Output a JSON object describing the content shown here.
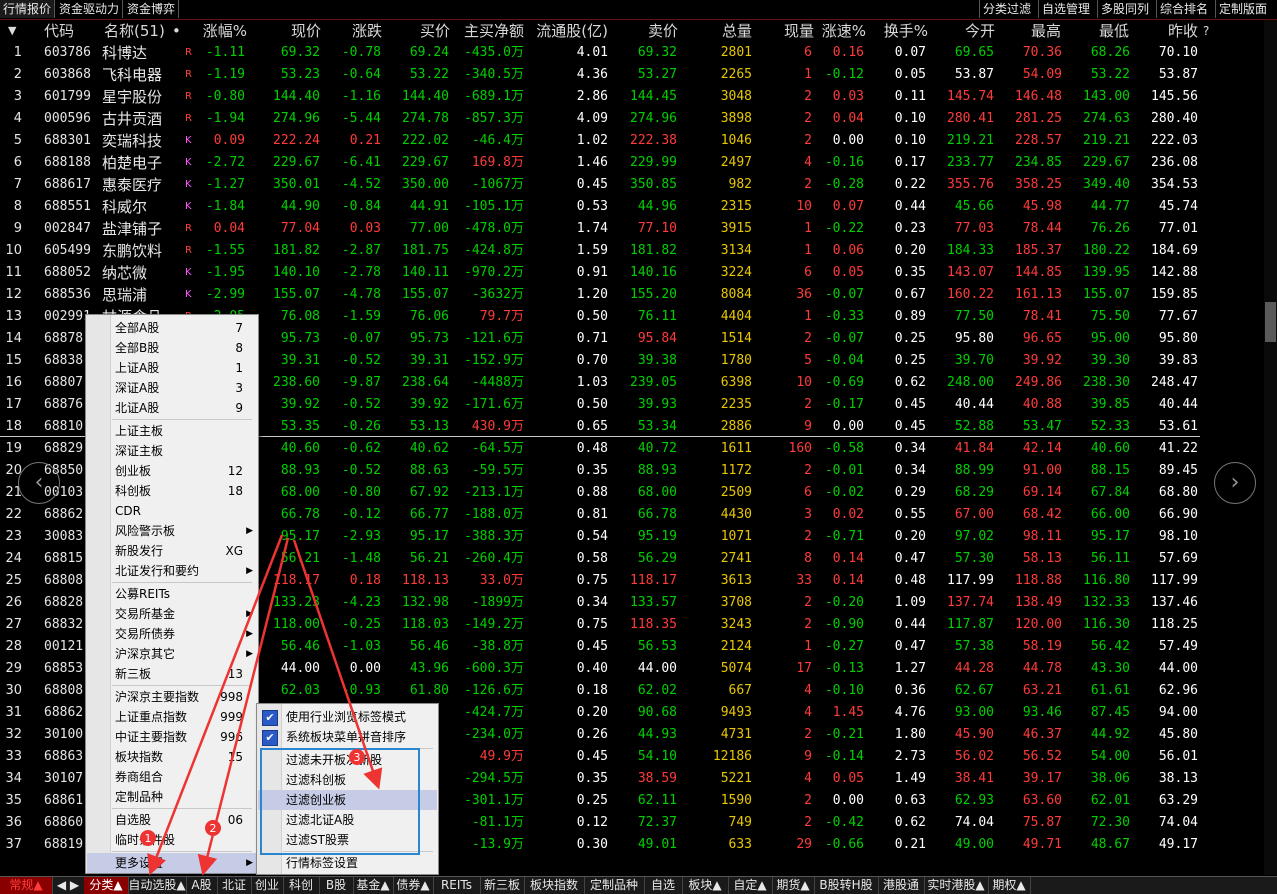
{
  "top_tabs": [
    "行情报价",
    "资金驱动力",
    "资金博弈"
  ],
  "top_right": [
    "分类过滤",
    "自选管理",
    "多股同列",
    "综合排名",
    "定制版面"
  ],
  "columns": [
    "代码",
    "名称(51)",
    "•",
    "涨幅%",
    "现价",
    "涨跌",
    "买价",
    "主买净额",
    "流通股(亿)",
    "卖价",
    "总量",
    "现量",
    "涨速%",
    "换手%",
    "今开",
    "最高",
    "最低",
    "昨收",
    "?"
  ],
  "rows": [
    {
      "n": "1",
      "code": "603786",
      "name": "科博达",
      "flag": "R",
      "chg_pct": "-1.11",
      "price": "69.32",
      "chg": "-0.78",
      "bid": "69.24",
      "net": "-435.0万",
      "float": "4.01",
      "ask": "69.32",
      "vol": "2801",
      "cur": "6",
      "speed": "0.16",
      "turn": "0.07",
      "open": "69.65",
      "high": "70.36",
      "low": "68.26",
      "prev": "70.10"
    },
    {
      "n": "2",
      "code": "603868",
      "name": "飞科电器",
      "flag": "R",
      "chg_pct": "-1.19",
      "price": "53.23",
      "chg": "-0.64",
      "bid": "53.22",
      "net": "-340.5万",
      "float": "4.36",
      "ask": "53.27",
      "vol": "2265",
      "cur": "1",
      "speed": "-0.12",
      "turn": "0.05",
      "open": "53.87",
      "high": "54.09",
      "low": "53.22",
      "prev": "53.87"
    },
    {
      "n": "3",
      "code": "601799",
      "name": "星宇股份",
      "flag": "R",
      "chg_pct": "-0.80",
      "price": "144.40",
      "chg": "-1.16",
      "bid": "144.40",
      "net": "-689.1万",
      "float": "2.86",
      "ask": "144.45",
      "vol": "3048",
      "cur": "2",
      "speed": "0.03",
      "turn": "0.11",
      "open": "145.74",
      "high": "146.48",
      "low": "143.00",
      "prev": "145.56"
    },
    {
      "n": "4",
      "code": "000596",
      "name": "古井贡酒",
      "flag": "R",
      "chg_pct": "-1.94",
      "price": "274.96",
      "chg": "-5.44",
      "bid": "274.78",
      "net": "-857.3万",
      "float": "4.09",
      "ask": "274.96",
      "vol": "3898",
      "cur": "2",
      "speed": "0.04",
      "turn": "0.10",
      "open": "280.41",
      "high": "281.25",
      "low": "274.63",
      "prev": "280.40"
    },
    {
      "n": "5",
      "code": "688301",
      "name": "奕瑞科技",
      "flag": "K",
      "chg_pct": "0.09",
      "price": "222.24",
      "chg": "0.21",
      "bid": "222.02",
      "net": "-46.4万",
      "float": "1.02",
      "ask": "222.38",
      "vol": "1046",
      "cur": "2",
      "speed": "0.00",
      "turn": "0.10",
      "open": "219.21",
      "high": "228.57",
      "low": "219.21",
      "prev": "222.03"
    },
    {
      "n": "6",
      "code": "688188",
      "name": "柏楚电子",
      "flag": "K",
      "chg_pct": "-2.72",
      "price": "229.67",
      "chg": "-6.41",
      "bid": "229.67",
      "net": "169.8万",
      "float": "1.46",
      "ask": "229.99",
      "vol": "2497",
      "cur": "4",
      "speed": "-0.16",
      "turn": "0.17",
      "open": "233.77",
      "high": "234.85",
      "low": "229.67",
      "prev": "236.08"
    },
    {
      "n": "7",
      "code": "688617",
      "name": "惠泰医疗",
      "flag": "K",
      "chg_pct": "-1.27",
      "price": "350.01",
      "chg": "-4.52",
      "bid": "350.00",
      "net": "-1067万",
      "float": "0.45",
      "ask": "350.85",
      "vol": "982",
      "cur": "2",
      "speed": "-0.28",
      "turn": "0.22",
      "open": "355.76",
      "high": "358.25",
      "low": "349.40",
      "prev": "354.53"
    },
    {
      "n": "8",
      "code": "688551",
      "name": "科威尔",
      "flag": "K",
      "chg_pct": "-1.84",
      "price": "44.90",
      "chg": "-0.84",
      "bid": "44.91",
      "net": "-105.1万",
      "float": "0.53",
      "ask": "44.96",
      "vol": "2315",
      "cur": "10",
      "speed": "0.07",
      "turn": "0.44",
      "open": "45.66",
      "high": "45.98",
      "low": "44.77",
      "prev": "45.74"
    },
    {
      "n": "9",
      "code": "002847",
      "name": "盐津铺子",
      "flag": "R",
      "chg_pct": "0.04",
      "price": "77.04",
      "chg": "0.03",
      "bid": "77.00",
      "net": "-478.0万",
      "float": "1.74",
      "ask": "77.10",
      "vol": "3915",
      "cur": "1",
      "speed": "-0.22",
      "turn": "0.23",
      "open": "77.03",
      "high": "78.44",
      "low": "76.26",
      "prev": "77.01"
    },
    {
      "n": "10",
      "code": "605499",
      "name": "东鹏饮料",
      "flag": "R",
      "chg_pct": "-1.55",
      "price": "181.82",
      "chg": "-2.87",
      "bid": "181.75",
      "net": "-424.8万",
      "float": "1.59",
      "ask": "181.82",
      "vol": "3134",
      "cur": "1",
      "speed": "0.06",
      "turn": "0.20",
      "open": "184.33",
      "high": "185.37",
      "low": "180.22",
      "prev": "184.69"
    },
    {
      "n": "11",
      "code": "688052",
      "name": "纳芯微",
      "flag": "K",
      "chg_pct": "-1.95",
      "price": "140.10",
      "chg": "-2.78",
      "bid": "140.11",
      "net": "-970.2万",
      "float": "0.91",
      "ask": "140.16",
      "vol": "3224",
      "cur": "6",
      "speed": "0.05",
      "turn": "0.35",
      "open": "143.07",
      "high": "144.85",
      "low": "139.95",
      "prev": "142.88"
    },
    {
      "n": "12",
      "code": "688536",
      "name": "思瑞浦",
      "flag": "K",
      "chg_pct": "-2.99",
      "price": "155.07",
      "chg": "-4.78",
      "bid": "155.07",
      "net": "-3632万",
      "float": "1.20",
      "ask": "155.20",
      "vol": "8084",
      "cur": "36",
      "speed": "-0.07",
      "turn": "0.67",
      "open": "160.22",
      "high": "161.13",
      "low": "155.07",
      "prev": "159.85"
    },
    {
      "n": "13",
      "code": "002991",
      "name": "甘源食品",
      "flag": "R",
      "chg_pct": "-2.05",
      "price": "76.08",
      "chg": "-1.59",
      "bid": "76.06",
      "net": "79.7万",
      "float": "0.50",
      "ask": "76.11",
      "vol": "4404",
      "cur": "1",
      "speed": "-0.33",
      "turn": "0.89",
      "open": "77.50",
      "high": "78.41",
      "low": "75.50",
      "prev": "77.67"
    },
    {
      "n": "14",
      "code": "68878",
      "name": "",
      "flag": "",
      "chg_pct": "",
      "price": "95.73",
      "chg": "-0.07",
      "bid": "95.73",
      "net": "-121.6万",
      "float": "0.71",
      "ask": "95.84",
      "vol": "1514",
      "cur": "2",
      "speed": "-0.07",
      "turn": "0.25",
      "open": "95.80",
      "high": "96.65",
      "low": "95.00",
      "prev": "95.80"
    },
    {
      "n": "15",
      "code": "68838",
      "name": "",
      "flag": "",
      "chg_pct": "",
      "price": "39.31",
      "chg": "-0.52",
      "bid": "39.31",
      "net": "-152.9万",
      "float": "0.70",
      "ask": "39.38",
      "vol": "1780",
      "cur": "5",
      "speed": "-0.04",
      "turn": "0.25",
      "open": "39.70",
      "high": "39.92",
      "low": "39.30",
      "prev": "39.83"
    },
    {
      "n": "16",
      "code": "68807",
      "name": "",
      "flag": "",
      "chg_pct": "",
      "price": "238.60",
      "chg": "-9.87",
      "bid": "238.64",
      "net": "-4488万",
      "float": "1.03",
      "ask": "239.05",
      "vol": "6398",
      "cur": "10",
      "speed": "-0.69",
      "turn": "0.62",
      "open": "248.00",
      "high": "249.86",
      "low": "238.30",
      "prev": "248.47"
    },
    {
      "n": "17",
      "code": "68876",
      "name": "",
      "flag": "",
      "chg_pct": "",
      "price": "39.92",
      "chg": "-0.52",
      "bid": "39.92",
      "net": "-171.6万",
      "float": "0.50",
      "ask": "39.93",
      "vol": "2235",
      "cur": "2",
      "speed": "-0.17",
      "turn": "0.45",
      "open": "40.44",
      "high": "40.88",
      "low": "39.85",
      "prev": "40.44"
    },
    {
      "n": "18",
      "code": "68810",
      "name": "",
      "flag": "",
      "chg_pct": "",
      "price": "53.35",
      "chg": "-0.26",
      "bid": "53.13",
      "net": "430.9万",
      "float": "0.65",
      "ask": "53.34",
      "vol": "2886",
      "cur": "9",
      "speed": "0.00",
      "turn": "0.45",
      "open": "52.88",
      "high": "53.47",
      "low": "52.33",
      "prev": "53.61"
    },
    {
      "n": "19",
      "code": "68829",
      "name": "",
      "flag": "",
      "chg_pct": "",
      "price": "40.60",
      "chg": "-0.62",
      "bid": "40.62",
      "net": "-64.5万",
      "float": "0.48",
      "ask": "40.72",
      "vol": "1611",
      "cur": "160",
      "speed": "-0.58",
      "turn": "0.34",
      "open": "41.84",
      "high": "42.14",
      "low": "40.60",
      "prev": "41.22"
    },
    {
      "n": "20",
      "code": "68850",
      "name": "",
      "flag": "",
      "chg_pct": "",
      "price": "88.93",
      "chg": "-0.52",
      "bid": "88.63",
      "net": "-59.5万",
      "float": "0.35",
      "ask": "88.93",
      "vol": "1172",
      "cur": "2",
      "speed": "-0.01",
      "turn": "0.34",
      "open": "88.99",
      "high": "91.00",
      "low": "88.15",
      "prev": "89.45"
    },
    {
      "n": "21",
      "code": "00103",
      "name": "",
      "flag": "",
      "chg_pct": "",
      "price": "68.00",
      "chg": "-0.80",
      "bid": "67.92",
      "net": "-213.1万",
      "float": "0.88",
      "ask": "68.00",
      "vol": "2509",
      "cur": "6",
      "speed": "-0.02",
      "turn": "0.29",
      "open": "68.29",
      "high": "69.14",
      "low": "67.84",
      "prev": "68.80"
    },
    {
      "n": "22",
      "code": "68862",
      "name": "",
      "flag": "",
      "chg_pct": "",
      "price": "66.78",
      "chg": "-0.12",
      "bid": "66.77",
      "net": "-188.0万",
      "float": "0.81",
      "ask": "66.78",
      "vol": "4430",
      "cur": "3",
      "speed": "0.02",
      "turn": "0.55",
      "open": "67.00",
      "high": "68.42",
      "low": "66.00",
      "prev": "66.90"
    },
    {
      "n": "23",
      "code": "30083",
      "name": "",
      "flag": "",
      "chg_pct": "",
      "price": "95.17",
      "chg": "-2.93",
      "bid": "95.17",
      "net": "-388.3万",
      "float": "0.54",
      "ask": "95.19",
      "vol": "1071",
      "cur": "2",
      "speed": "-0.71",
      "turn": "0.20",
      "open": "97.02",
      "high": "98.11",
      "low": "95.17",
      "prev": "98.10"
    },
    {
      "n": "24",
      "code": "68815",
      "name": "",
      "flag": "",
      "chg_pct": "",
      "price": "56.21",
      "chg": "-1.48",
      "bid": "56.21",
      "net": "-260.4万",
      "float": "0.58",
      "ask": "56.29",
      "vol": "2741",
      "cur": "8",
      "speed": "0.14",
      "turn": "0.47",
      "open": "57.30",
      "high": "58.13",
      "low": "56.11",
      "prev": "57.69"
    },
    {
      "n": "25",
      "code": "68808",
      "name": "",
      "flag": "",
      "chg_pct": "",
      "price": "118.17",
      "chg": "0.18",
      "bid": "118.13",
      "net": "33.0万",
      "float": "0.75",
      "ask": "118.17",
      "vol": "3613",
      "cur": "33",
      "speed": "0.14",
      "turn": "0.48",
      "open": "117.99",
      "high": "118.88",
      "low": "116.80",
      "prev": "117.99"
    },
    {
      "n": "26",
      "code": "68828",
      "name": "",
      "flag": "",
      "chg_pct": "",
      "price": "133.23",
      "chg": "-4.23",
      "bid": "132.98",
      "net": "-1899万",
      "float": "0.34",
      "ask": "133.57",
      "vol": "3708",
      "cur": "2",
      "speed": "-0.20",
      "turn": "1.09",
      "open": "137.74",
      "high": "138.49",
      "low": "132.33",
      "prev": "137.46"
    },
    {
      "n": "27",
      "code": "68832",
      "name": "",
      "flag": "",
      "chg_pct": "",
      "price": "118.00",
      "chg": "-0.25",
      "bid": "118.03",
      "net": "-149.2万",
      "float": "0.75",
      "ask": "118.35",
      "vol": "3243",
      "cur": "2",
      "speed": "-0.90",
      "turn": "0.44",
      "open": "117.87",
      "high": "120.00",
      "low": "116.30",
      "prev": "118.25"
    },
    {
      "n": "28",
      "code": "00121",
      "name": "",
      "flag": "",
      "chg_pct": "",
      "price": "56.46",
      "chg": "-1.03",
      "bid": "56.46",
      "net": "-38.8万",
      "float": "0.45",
      "ask": "56.53",
      "vol": "2124",
      "cur": "1",
      "speed": "-0.27",
      "turn": "0.47",
      "open": "57.38",
      "high": "58.19",
      "low": "56.42",
      "prev": "57.49"
    },
    {
      "n": "29",
      "code": "68853",
      "name": "",
      "flag": "",
      "chg_pct": "",
      "price": "44.00",
      "chg": "0.00",
      "bid": "43.96",
      "net": "-600.3万",
      "float": "0.40",
      "ask": "44.00",
      "vol": "5074",
      "cur": "17",
      "speed": "-0.13",
      "turn": "1.27",
      "open": "44.28",
      "high": "44.78",
      "low": "43.30",
      "prev": "44.00"
    },
    {
      "n": "30",
      "code": "68808",
      "name": "",
      "flag": "",
      "chg_pct": "",
      "price": "62.03",
      "chg": "-0.93",
      "bid": "61.80",
      "net": "-126.6万",
      "float": "0.18",
      "ask": "62.02",
      "vol": "667",
      "cur": "4",
      "speed": "-0.10",
      "turn": "0.36",
      "open": "62.67",
      "high": "63.21",
      "low": "61.61",
      "prev": "62.96"
    },
    {
      "n": "31",
      "code": "68862",
      "name": "",
      "flag": "",
      "chg_pct": "",
      "price": "",
      "chg": "",
      "bid": "",
      "net": "-424.7万",
      "float": "0.20",
      "ask": "90.68",
      "vol": "9493",
      "cur": "4",
      "speed": "1.45",
      "turn": "4.76",
      "open": "93.00",
      "high": "93.46",
      "low": "87.45",
      "prev": "94.00"
    },
    {
      "n": "32",
      "code": "30100",
      "name": "",
      "flag": "",
      "chg_pct": "",
      "price": "",
      "chg": "",
      "bid": "",
      "net": "-234.0万",
      "float": "0.26",
      "ask": "44.93",
      "vol": "4731",
      "cur": "2",
      "speed": "-0.21",
      "turn": "1.80",
      "open": "45.90",
      "high": "46.37",
      "low": "44.92",
      "prev": "45.80"
    },
    {
      "n": "33",
      "code": "68863",
      "name": "",
      "flag": "",
      "chg_pct": "",
      "price": "",
      "chg": "",
      "bid": "",
      "net": "49.9万",
      "float": "0.45",
      "ask": "54.10",
      "vol": "12186",
      "cur": "9",
      "speed": "-0.14",
      "turn": "2.73",
      "open": "56.02",
      "high": "56.52",
      "low": "54.00",
      "prev": "56.01"
    },
    {
      "n": "34",
      "code": "30107",
      "name": "",
      "flag": "",
      "chg_pct": "",
      "price": "",
      "chg": "",
      "bid": "",
      "net": "-294.5万",
      "float": "0.35",
      "ask": "38.59",
      "vol": "5221",
      "cur": "4",
      "speed": "0.05",
      "turn": "1.49",
      "open": "38.41",
      "high": "39.17",
      "low": "38.06",
      "prev": "38.13"
    },
    {
      "n": "35",
      "code": "68861",
      "name": "",
      "flag": "",
      "chg_pct": "",
      "price": "",
      "chg": "",
      "bid": "",
      "net": "-301.1万",
      "float": "0.25",
      "ask": "62.11",
      "vol": "1590",
      "cur": "2",
      "speed": "0.00",
      "turn": "0.63",
      "open": "62.93",
      "high": "63.60",
      "low": "62.01",
      "prev": "63.29"
    },
    {
      "n": "36",
      "code": "68860",
      "name": "",
      "flag": "",
      "chg_pct": "",
      "price": "",
      "chg": "",
      "bid": "",
      "net": "-81.1万",
      "float": "0.12",
      "ask": "72.37",
      "vol": "749",
      "cur": "2",
      "speed": "-0.42",
      "turn": "0.62",
      "open": "74.04",
      "high": "75.87",
      "low": "72.30",
      "prev": "74.04"
    },
    {
      "n": "37",
      "code": "68819",
      "name": "",
      "flag": "",
      "chg_pct": "",
      "price": "",
      "chg": "",
      "bid": "",
      "net": "-13.9万",
      "float": "0.30",
      "ask": "49.01",
      "vol": "633",
      "cur": "29",
      "speed": "-0.66",
      "turn": "0.21",
      "open": "49.00",
      "high": "49.71",
      "low": "48.67",
      "prev": "49.17"
    }
  ],
  "menu_main": [
    {
      "label": "全部A股",
      "sc": "7"
    },
    {
      "label": "全部B股",
      "sc": "8"
    },
    {
      "label": "上证A股",
      "sc": "1"
    },
    {
      "label": "深证A股",
      "sc": "3"
    },
    {
      "label": "北证A股",
      "sc": "9"
    },
    {
      "sep": true
    },
    {
      "label": "上证主板",
      "sc": ""
    },
    {
      "label": "深证主板",
      "sc": ""
    },
    {
      "label": "创业板",
      "sc": "12"
    },
    {
      "label": "科创板",
      "sc": "18"
    },
    {
      "label": "CDR",
      "sc": ""
    },
    {
      "label": "风险警示板",
      "sc": "",
      "sub": true
    },
    {
      "label": "新股发行",
      "sc": "XG"
    },
    {
      "label": "北证发行和要约",
      "sc": "",
      "sub": true
    },
    {
      "sep": true
    },
    {
      "label": "公募REITs",
      "sc": ""
    },
    {
      "label": "交易所基金",
      "sc": "",
      "sub": true
    },
    {
      "label": "交易所债券",
      "sc": "",
      "sub": true
    },
    {
      "label": "沪深京其它",
      "sc": "",
      "sub": true
    },
    {
      "label": "新三板",
      "sc": "13"
    },
    {
      "sep": true
    },
    {
      "label": "沪深京主要指数",
      "sc": "998"
    },
    {
      "label": "上证重点指数",
      "sc": "999"
    },
    {
      "label": "中证主要指数",
      "sc": "996"
    },
    {
      "label": "板块指数",
      "sc": "15"
    },
    {
      "label": "券商组合",
      "sc": ""
    },
    {
      "label": "定制品种",
      "sc": ""
    },
    {
      "sep": true
    },
    {
      "label": "自选股",
      "sc": "06"
    },
    {
      "label": "临时条件股",
      "sc": ""
    },
    {
      "sep": true
    },
    {
      "label": "更多设置",
      "sc": "",
      "sub": true,
      "hl": true
    }
  ],
  "menu_sub": [
    {
      "label": "使用行业浏览标签模式",
      "checked": true
    },
    {
      "label": "系统板块菜单拼音排序",
      "checked": true
    },
    {
      "sep": true
    },
    {
      "label": "过滤未开板次新股",
      "checked": false
    },
    {
      "label": "过滤科创板",
      "checked": false
    },
    {
      "label": "过滤创业板",
      "checked": false,
      "hl": true
    },
    {
      "label": "过滤北证A股",
      "checked": false
    },
    {
      "label": "过滤ST股票",
      "checked": false
    },
    {
      "sep": true
    },
    {
      "label": "行情标签设置",
      "checked": false
    }
  ],
  "annotations": [
    "1",
    "2",
    "3"
  ],
  "bottom_tabs": [
    "常规▲",
    "◀ ▶",
    "分类▲",
    "自动选股▲",
    "A股",
    "北证",
    "创业",
    "科创",
    "B股",
    "基金▲",
    "债券▲",
    "REITs",
    "新三板",
    "板块指数",
    "定制品种",
    "自选",
    "板块▲",
    "自定▲",
    "期货▲",
    "B股转H股",
    "港股通",
    "实时港股▲",
    "期权▲"
  ],
  "colors": {
    "up": "#ff3b3b",
    "down": "#00d000",
    "flat": "#ffffff",
    "volume": "#e8c800",
    "annotation": "#e33"
  }
}
